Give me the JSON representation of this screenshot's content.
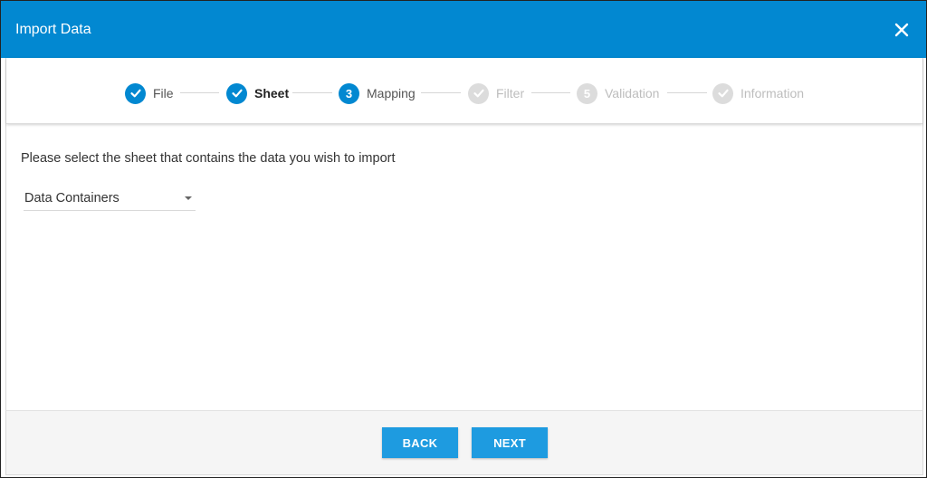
{
  "dialog": {
    "title": "Import Data",
    "close_icon": "close-icon"
  },
  "stepper": {
    "steps": [
      {
        "label": "File",
        "state": "done",
        "marker": "check-icon"
      },
      {
        "label": "Sheet",
        "state": "active",
        "marker": "check-icon"
      },
      {
        "label": "Mapping",
        "state": "current",
        "marker": "3"
      },
      {
        "label": "Filter",
        "state": "pending",
        "marker": "check-icon"
      },
      {
        "label": "Validation",
        "state": "pending",
        "marker": "5"
      },
      {
        "label": "Information",
        "state": "pending",
        "marker": "check-icon"
      }
    ]
  },
  "content": {
    "instruction": "Please select the sheet that contains the data you wish to import",
    "sheet_select": {
      "value": "Data Containers",
      "icon": "caret-down-icon"
    }
  },
  "footer": {
    "back_label": "BACK",
    "next_label": "NEXT"
  },
  "colors": {
    "header": "#0288d1",
    "step_active": "#0288d1",
    "step_pending": "#dcdcdc",
    "button": "#1e9be0",
    "footer_bg": "#f5f5f5"
  }
}
